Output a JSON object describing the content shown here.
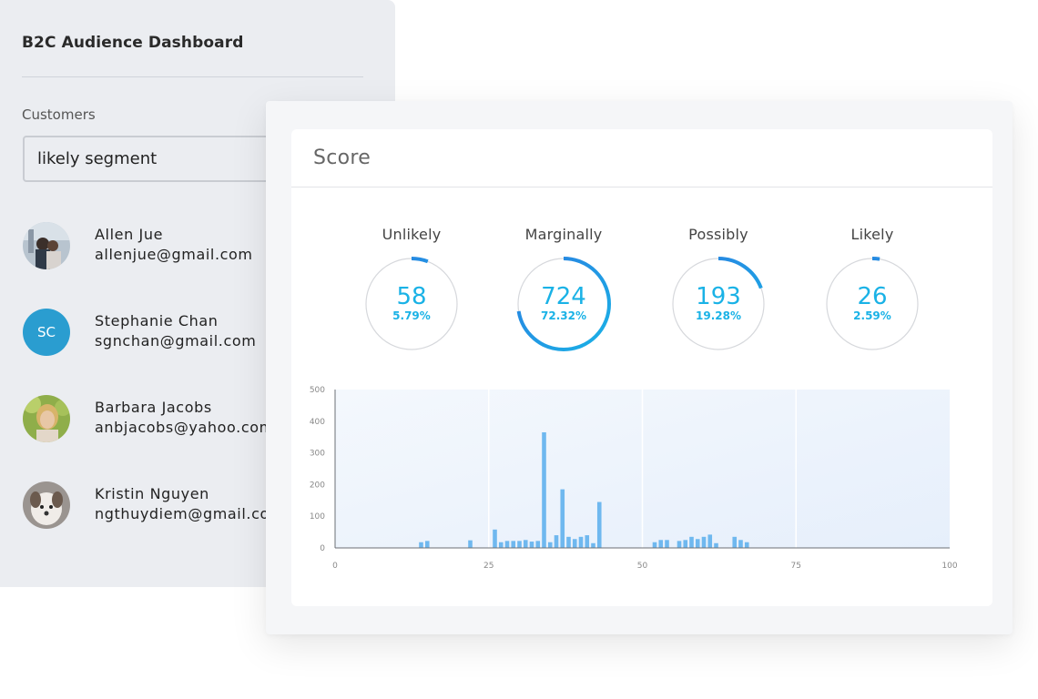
{
  "dashboard": {
    "title": "B2C Audience Dashboard",
    "section_label": "Customers",
    "segment_value": "likely segment",
    "customers": [
      {
        "name": "Allen Jue",
        "email": "allenjue@gmail.com",
        "avatar": "photo"
      },
      {
        "name": "Stephanie Chan",
        "email": "sgnchan@gmail.com",
        "avatar_initials": "SC",
        "avatar_color": "#2a9dd0"
      },
      {
        "name": "Barbara Jacobs",
        "email": "anbjacobs@yahoo.com",
        "avatar": "photo"
      },
      {
        "name": "Kristin Nguyen",
        "email": "ngthuydiem@gmail.com",
        "avatar": "photo"
      }
    ]
  },
  "score": {
    "title": "Score",
    "gauges": [
      {
        "label": "Unlikely",
        "count": "58",
        "percent": "5.79%",
        "fraction": 0.0579
      },
      {
        "label": "Marginally",
        "count": "724",
        "percent": "72.32%",
        "fraction": 0.7232
      },
      {
        "label": "Possibly",
        "count": "193",
        "percent": "19.28%",
        "fraction": 0.1928
      },
      {
        "label": "Likely",
        "count": "26",
        "percent": "2.59%",
        "fraction": 0.0259
      }
    ]
  },
  "colors": {
    "accent": "#1ab2e6",
    "gauge_arc_start": "#1ab2e6",
    "gauge_arc_end": "#2a7de1",
    "bar": "#6fb8ef",
    "track": "#d6d8dc"
  },
  "chart_data": {
    "type": "bar",
    "x_ticks": [
      "0",
      "25",
      "50",
      "75",
      "100"
    ],
    "y_ticks": [
      "0",
      "100",
      "200",
      "300",
      "400",
      "500"
    ],
    "xlim": [
      0,
      100
    ],
    "ylim": [
      0,
      500
    ],
    "regions": [
      [
        0,
        25
      ],
      [
        25,
        50
      ],
      [
        50,
        75
      ],
      [
        75,
        100
      ]
    ],
    "x": [
      14,
      15,
      22,
      26,
      27,
      28,
      29,
      30,
      31,
      32,
      33,
      34,
      35,
      36,
      37,
      38,
      39,
      40,
      41,
      42,
      43,
      44,
      45,
      46,
      47,
      48,
      49,
      50,
      51,
      52,
      53,
      54,
      55,
      56,
      57,
      58,
      59,
      60,
      61,
      62,
      63,
      64,
      65,
      66,
      67,
      76,
      77,
      78
    ],
    "values": [
      18,
      22,
      24,
      58,
      18,
      22,
      22,
      22,
      25,
      20,
      22,
      365,
      18,
      40,
      185,
      35,
      28,
      35,
      40,
      15,
      145,
      0,
      0,
      0,
      0,
      0,
      0,
      0,
      0,
      18,
      25,
      25,
      0,
      22,
      25,
      35,
      28,
      35,
      42,
      15,
      0,
      0,
      35,
      25,
      18,
      0,
      0,
      0
    ],
    "title": "",
    "xlabel": "",
    "ylabel": "",
    "grid": false
  }
}
